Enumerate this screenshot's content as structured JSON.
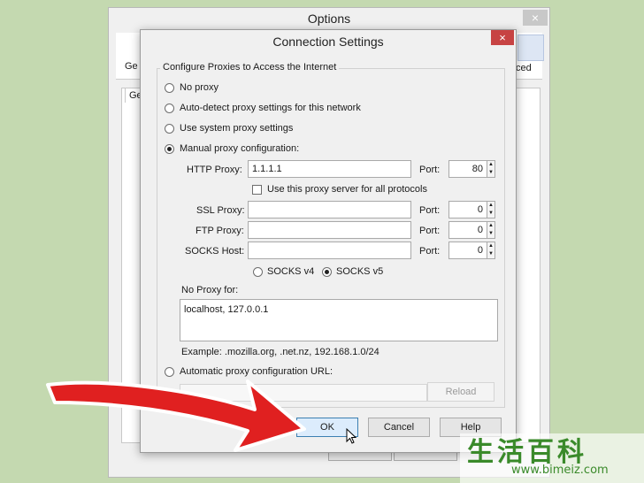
{
  "options_window": {
    "title": "Options",
    "close_glyph": "×",
    "tab_general_fragment": "Ge",
    "tab_advanced_fragment": "ced",
    "panel_tab_fragment": "Gen"
  },
  "dialog": {
    "title": "Connection Settings",
    "close_glyph": "×",
    "group_title": "Configure Proxies to Access the Internet",
    "options": {
      "no_proxy": "No proxy",
      "auto_detect": "Auto-detect proxy settings for this network",
      "use_system": "Use system proxy settings",
      "manual": "Manual proxy configuration:",
      "automatic_url": "Automatic proxy configuration URL:"
    },
    "selected_option": "manual",
    "http": {
      "label": "HTTP Proxy:",
      "value": "1.1.1.1",
      "port_label": "Port:",
      "port_value": "80"
    },
    "use_for_all": {
      "label": "Use this proxy server for all protocols",
      "checked": false
    },
    "ssl": {
      "label": "SSL Proxy:",
      "value": "",
      "port_label": "Port:",
      "port_value": "0"
    },
    "ftp": {
      "label": "FTP Proxy:",
      "value": "",
      "port_label": "Port:",
      "port_value": "0"
    },
    "socks": {
      "label": "SOCKS Host:",
      "value": "",
      "port_label": "Port:",
      "port_value": "0"
    },
    "socks_v4": "SOCKS v4",
    "socks_v5": "SOCKS v5",
    "socks_selected": "v5",
    "no_proxy_for_label": "No Proxy for:",
    "no_proxy_for_value": "localhost, 127.0.0.1",
    "example": "Example: .mozilla.org, .net.nz, 192.168.1.0/24",
    "auto_url_value": "",
    "reload_label": "Reload",
    "ok_label": "OK",
    "cancel_label": "Cancel",
    "help_label": "Help"
  },
  "annotation": {
    "arrow_color": "#e02020",
    "arrow_outline": "#ffffff"
  },
  "watermark": {
    "chinese": "生活百科",
    "url": "www.bimeiz.com"
  }
}
